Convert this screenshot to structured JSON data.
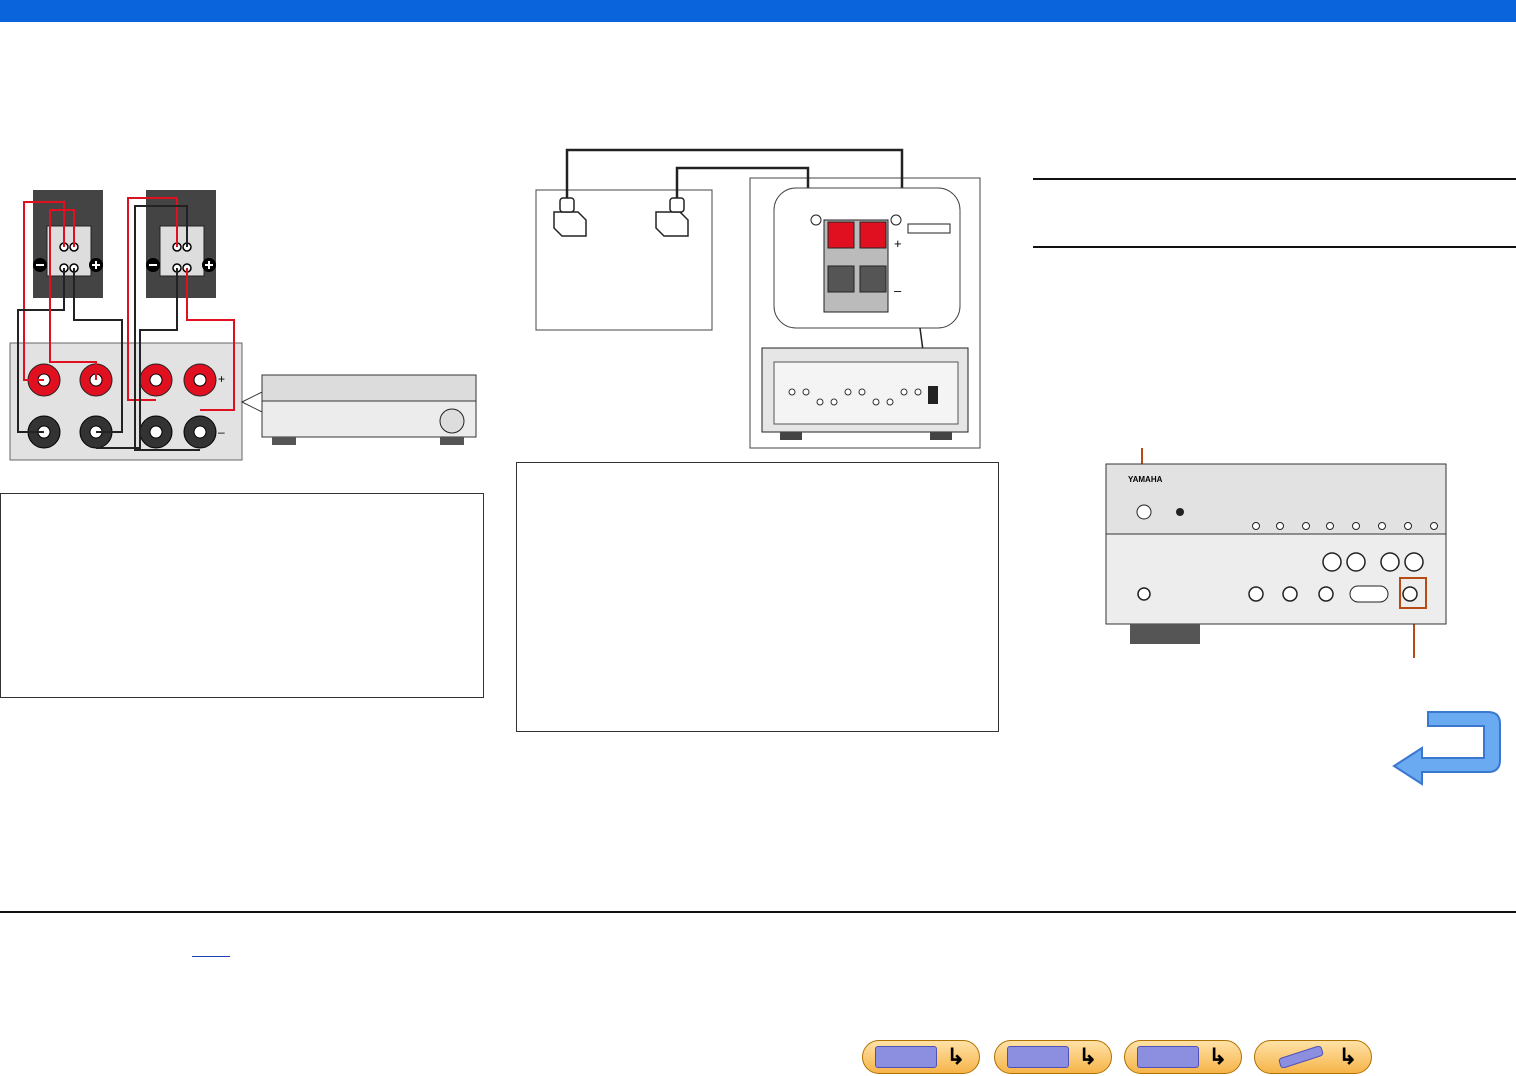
{
  "header": {
    "bar_color": "#0a64dc"
  },
  "figures": {
    "bi_amp": {
      "plus": "+",
      "minus": "–"
    },
    "zone_b": {
      "plus": "+",
      "minus": "–"
    },
    "front_panel": {
      "brand": "YAMAHA"
    }
  },
  "nav": {
    "buttons": [
      {
        "icon": "front-panel-icon",
        "arrow": "↳"
      },
      {
        "icon": "rear-panel-icon",
        "arrow": "↳"
      },
      {
        "icon": "display-icon",
        "arrow": "↳"
      },
      {
        "icon": "remote-control-icon",
        "arrow": "↳"
      }
    ]
  },
  "colors": {
    "accent": "#0a64dc",
    "terminal_red": "#e01020",
    "callout": "#b84a14",
    "return_arrow": "#4a8ee0"
  }
}
